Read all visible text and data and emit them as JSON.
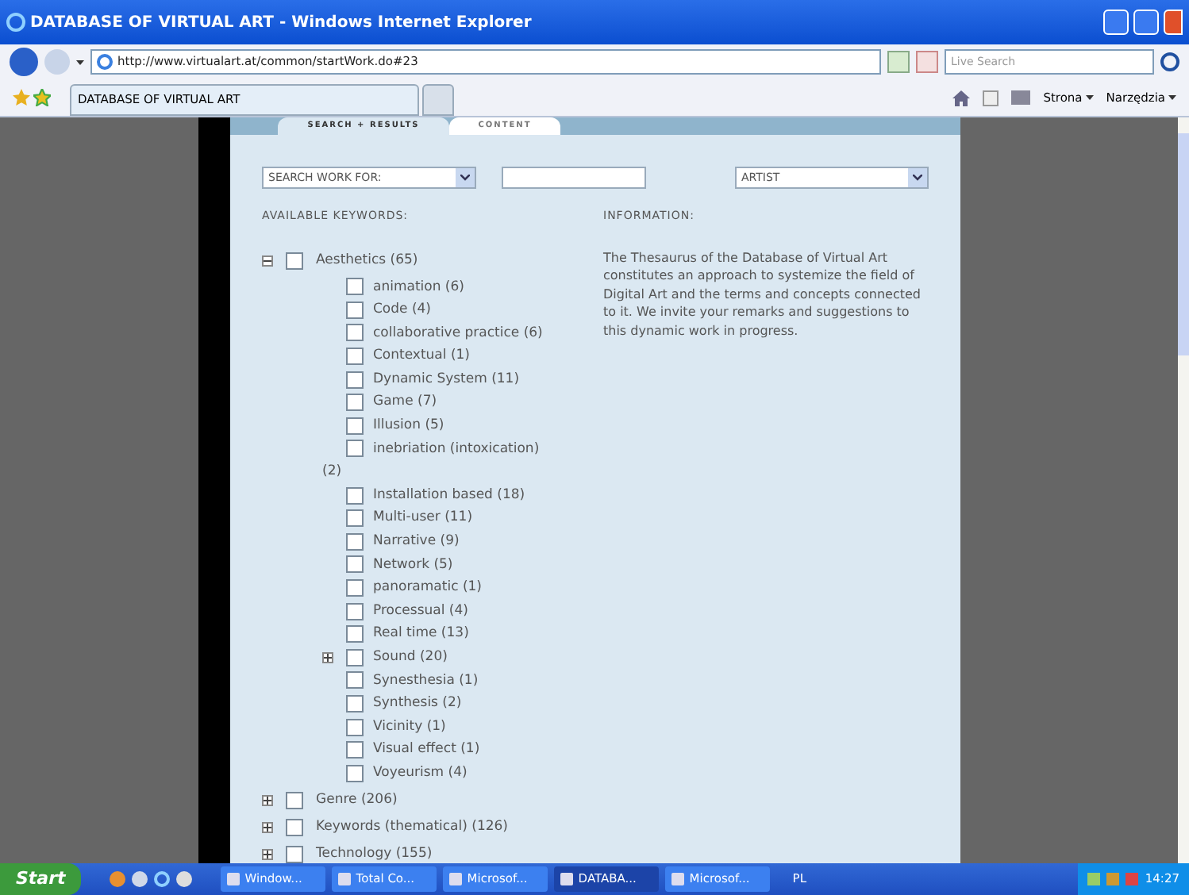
{
  "window": {
    "title": "DATABASE OF VIRTUAL ART - Windows Internet Explorer"
  },
  "address_bar": {
    "url": "http://www.virtualart.at/common/startWork.do#23"
  },
  "search_box": {
    "placeholder": "Live Search"
  },
  "browser_tabs": [
    {
      "label": "DATABASE OF VIRTUAL ART",
      "selected": true
    },
    {
      "selected": false
    }
  ],
  "toolbar": {
    "items": [
      {
        "label": "Strona"
      },
      {
        "label": "Narzędzia"
      }
    ]
  },
  "page": {
    "tabs": [
      {
        "label": "SEARCH + RESULTS",
        "selected": true
      },
      {
        "label": "CONTENT",
        "selected": false
      }
    ],
    "search_for_select": {
      "value": "SEARCH WORK FOR:"
    },
    "type_select": {
      "value": "ARTIST"
    },
    "keywords_heading": "AVAILABLE KEYWORDS:",
    "information_heading": "INFORMATION:",
    "information_text": "The Thesaurus of the Database of Virtual Art constitutes an approach to systemize the field of Digital Art and the terms and concepts connected to it. We invite your remarks and suggestions to this dynamic work in progress.",
    "keywords": [
      {
        "label": "Aesthetics (65)",
        "checked": false,
        "expanded": true,
        "children": [
          {
            "label": "animation (6)",
            "checked": false
          },
          {
            "label": "Code (4)",
            "checked": false
          },
          {
            "label": "collaborative practice (6)",
            "checked": false
          },
          {
            "label": "Contextual (1)",
            "checked": false
          },
          {
            "label": "Dynamic System (11)",
            "checked": false
          },
          {
            "label": "Game (7)",
            "checked": false
          },
          {
            "label": "Illusion (5)",
            "checked": false
          },
          {
            "label": "inebriation (intoxication)\n(2)",
            "checked": false
          },
          {
            "label": "Installation based (18)",
            "checked": false
          },
          {
            "label": "Multi-user (11)",
            "checked": false
          },
          {
            "label": "Narrative (9)",
            "checked": false
          },
          {
            "label": "Network (5)",
            "checked": false
          },
          {
            "label": "panoramatic (1)",
            "checked": false
          },
          {
            "label": "Processual (4)",
            "checked": false
          },
          {
            "label": "Real time (13)",
            "checked": false
          },
          {
            "label": "Sound (20)",
            "checked": false,
            "expanded": false
          },
          {
            "label": "Synesthesia (1)",
            "checked": false
          },
          {
            "label": "Synthesis (2)",
            "checked": false
          },
          {
            "label": "Vicinity (1)",
            "checked": false
          },
          {
            "label": "Visual effect (1)",
            "checked": false
          },
          {
            "label": "Voyeurism (4)",
            "checked": false
          }
        ]
      },
      {
        "label": "Genre (206)",
        "checked": false,
        "expanded": false
      },
      {
        "label": "Keywords (thematical) (126)",
        "checked": false,
        "expanded": false
      },
      {
        "label": "Technology (155)",
        "checked": false,
        "expanded": false
      }
    ]
  },
  "taskbar": {
    "start": "Start",
    "tasks": [
      {
        "label": "Window...",
        "selected": false
      },
      {
        "label": "Total Co...",
        "selected": false
      },
      {
        "label": "Microsof...",
        "selected": false
      },
      {
        "label": "DATABA...",
        "selected": true
      },
      {
        "label": "Microsof...",
        "selected": false
      }
    ],
    "language": "PL",
    "clock": "14:27"
  }
}
